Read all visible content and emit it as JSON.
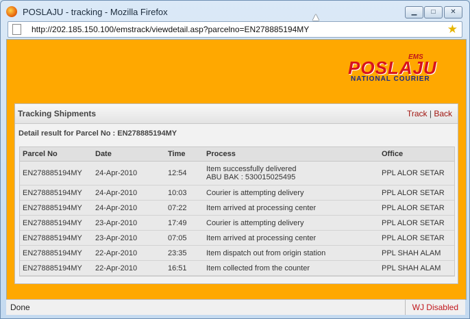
{
  "window": {
    "title": "POSLAJU - tracking - Mozilla Firefox",
    "url": "http://202.185.150.100/emstrack/viewdetail.asp?parcelno=EN278885194MY"
  },
  "logo": {
    "ems": "EMS",
    "main": "POSLAJU",
    "sub": "NATIONAL COURIER"
  },
  "panel": {
    "title": "Tracking Shipments",
    "link_track": "Track",
    "separator": "|",
    "link_back": "Back",
    "detail": "Detail result for Parcel No : EN278885194MY"
  },
  "table": {
    "headers": [
      "Parcel No",
      "Date",
      "Time",
      "Process",
      "Office"
    ],
    "rows": [
      {
        "parcel": "EN278885194MY",
        "date": "24-Apr-2010",
        "time": "12:54",
        "process": "Item successfully delivered",
        "process2": "ABU BAK : 530015025495",
        "office": "PPL ALOR SETAR"
      },
      {
        "parcel": "EN278885194MY",
        "date": "24-Apr-2010",
        "time": "10:03",
        "process": "Courier is attempting delivery",
        "office": "PPL ALOR SETAR"
      },
      {
        "parcel": "EN278885194MY",
        "date": "24-Apr-2010",
        "time": "07:22",
        "process": "Item arrived at processing center",
        "office": "PPL ALOR SETAR"
      },
      {
        "parcel": "EN278885194MY",
        "date": "23-Apr-2010",
        "time": "17:49",
        "process": "Courier is attempting delivery",
        "office": "PPL ALOR SETAR"
      },
      {
        "parcel": "EN278885194MY",
        "date": "23-Apr-2010",
        "time": "07:05",
        "process": "Item arrived at processing center",
        "office": "PPL ALOR SETAR"
      },
      {
        "parcel": "EN278885194MY",
        "date": "22-Apr-2010",
        "time": "23:35",
        "process": "Item dispatch out from origin station",
        "office": "PPL SHAH ALAM"
      },
      {
        "parcel": "EN278885194MY",
        "date": "22-Apr-2010",
        "time": "16:51",
        "process": "Item collected from the counter",
        "office": "PPL SHAH ALAM"
      }
    ]
  },
  "status": {
    "left": "Done",
    "right": "WJ Disabled"
  },
  "colors": {
    "page_bg": "#ffa800",
    "link": "#a0140f"
  }
}
